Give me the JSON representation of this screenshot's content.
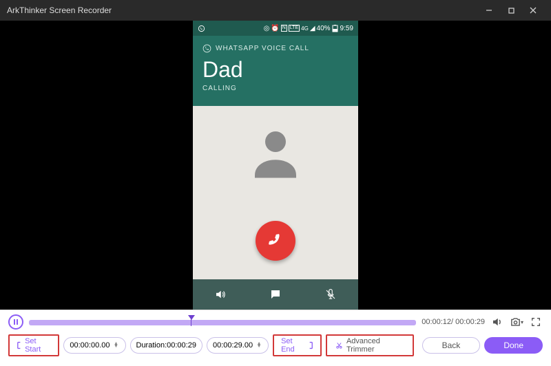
{
  "titlebar": {
    "title": "ArkThinker Screen Recorder"
  },
  "phone": {
    "statusbar": {
      "battery": "40%",
      "time": "9:59"
    },
    "call": {
      "type": "WHATSAPP VOICE CALL",
      "name": "Dad",
      "status": "CALLING"
    }
  },
  "playback": {
    "current": "00:00:12",
    "total": "00:00:29"
  },
  "trim": {
    "set_start_label": "Set Start",
    "start_time": "00:00:00.00",
    "duration_label": "Duration:00:00:29",
    "end_time": "00:00:29.00",
    "set_end_label": "Set End",
    "advanced_label": "Advanced Trimmer"
  },
  "buttons": {
    "back": "Back",
    "done": "Done"
  }
}
